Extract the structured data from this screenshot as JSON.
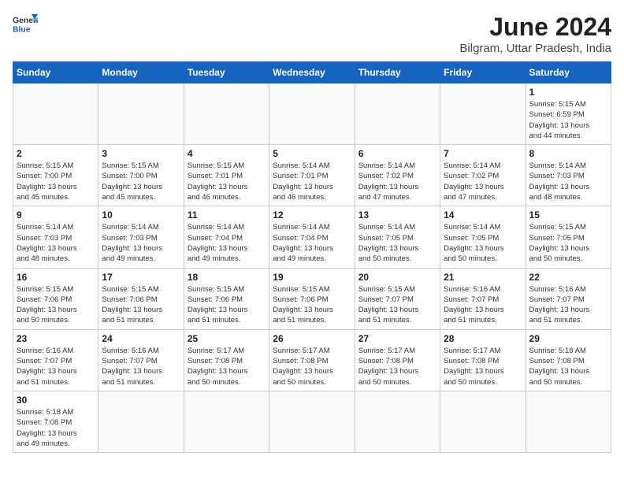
{
  "header": {
    "logo_general": "General",
    "logo_blue": "Blue",
    "month_title": "June 2024",
    "subtitle": "Bilgram, Uttar Pradesh, India"
  },
  "weekdays": [
    "Sunday",
    "Monday",
    "Tuesday",
    "Wednesday",
    "Thursday",
    "Friday",
    "Saturday"
  ],
  "weeks": [
    [
      {
        "day": "",
        "info": ""
      },
      {
        "day": "",
        "info": ""
      },
      {
        "day": "",
        "info": ""
      },
      {
        "day": "",
        "info": ""
      },
      {
        "day": "",
        "info": ""
      },
      {
        "day": "",
        "info": ""
      },
      {
        "day": "1",
        "info": "Sunrise: 5:15 AM\nSunset: 6:59 PM\nDaylight: 13 hours\nand 44 minutes."
      }
    ],
    [
      {
        "day": "2",
        "info": "Sunrise: 5:15 AM\nSunset: 7:00 PM\nDaylight: 13 hours\nand 45 minutes."
      },
      {
        "day": "3",
        "info": "Sunrise: 5:15 AM\nSunset: 7:00 PM\nDaylight: 13 hours\nand 45 minutes."
      },
      {
        "day": "4",
        "info": "Sunrise: 5:15 AM\nSunset: 7:01 PM\nDaylight: 13 hours\nand 46 minutes."
      },
      {
        "day": "5",
        "info": "Sunrise: 5:14 AM\nSunset: 7:01 PM\nDaylight: 13 hours\nand 46 minutes."
      },
      {
        "day": "6",
        "info": "Sunrise: 5:14 AM\nSunset: 7:02 PM\nDaylight: 13 hours\nand 47 minutes."
      },
      {
        "day": "7",
        "info": "Sunrise: 5:14 AM\nSunset: 7:02 PM\nDaylight: 13 hours\nand 47 minutes."
      },
      {
        "day": "8",
        "info": "Sunrise: 5:14 AM\nSunset: 7:03 PM\nDaylight: 13 hours\nand 48 minutes."
      }
    ],
    [
      {
        "day": "9",
        "info": "Sunrise: 5:14 AM\nSunset: 7:03 PM\nDaylight: 13 hours\nand 48 minutes."
      },
      {
        "day": "10",
        "info": "Sunrise: 5:14 AM\nSunset: 7:03 PM\nDaylight: 13 hours\nand 49 minutes."
      },
      {
        "day": "11",
        "info": "Sunrise: 5:14 AM\nSunset: 7:04 PM\nDaylight: 13 hours\nand 49 minutes."
      },
      {
        "day": "12",
        "info": "Sunrise: 5:14 AM\nSunset: 7:04 PM\nDaylight: 13 hours\nand 49 minutes."
      },
      {
        "day": "13",
        "info": "Sunrise: 5:14 AM\nSunset: 7:05 PM\nDaylight: 13 hours\nand 50 minutes."
      },
      {
        "day": "14",
        "info": "Sunrise: 5:14 AM\nSunset: 7:05 PM\nDaylight: 13 hours\nand 50 minutes."
      },
      {
        "day": "15",
        "info": "Sunrise: 5:15 AM\nSunset: 7:05 PM\nDaylight: 13 hours\nand 50 minutes."
      }
    ],
    [
      {
        "day": "16",
        "info": "Sunrise: 5:15 AM\nSunset: 7:06 PM\nDaylight: 13 hours\nand 50 minutes."
      },
      {
        "day": "17",
        "info": "Sunrise: 5:15 AM\nSunset: 7:06 PM\nDaylight: 13 hours\nand 51 minutes."
      },
      {
        "day": "18",
        "info": "Sunrise: 5:15 AM\nSunset: 7:06 PM\nDaylight: 13 hours\nand 51 minutes."
      },
      {
        "day": "19",
        "info": "Sunrise: 5:15 AM\nSunset: 7:06 PM\nDaylight: 13 hours\nand 51 minutes."
      },
      {
        "day": "20",
        "info": "Sunrise: 5:15 AM\nSunset: 7:07 PM\nDaylight: 13 hours\nand 51 minutes."
      },
      {
        "day": "21",
        "info": "Sunrise: 5:16 AM\nSunset: 7:07 PM\nDaylight: 13 hours\nand 51 minutes."
      },
      {
        "day": "22",
        "info": "Sunrise: 5:16 AM\nSunset: 7:07 PM\nDaylight: 13 hours\nand 51 minutes."
      }
    ],
    [
      {
        "day": "23",
        "info": "Sunrise: 5:16 AM\nSunset: 7:07 PM\nDaylight: 13 hours\nand 51 minutes."
      },
      {
        "day": "24",
        "info": "Sunrise: 5:16 AM\nSunset: 7:07 PM\nDaylight: 13 hours\nand 51 minutes."
      },
      {
        "day": "25",
        "info": "Sunrise: 5:17 AM\nSunset: 7:08 PM\nDaylight: 13 hours\nand 50 minutes."
      },
      {
        "day": "26",
        "info": "Sunrise: 5:17 AM\nSunset: 7:08 PM\nDaylight: 13 hours\nand 50 minutes."
      },
      {
        "day": "27",
        "info": "Sunrise: 5:17 AM\nSunset: 7:08 PM\nDaylight: 13 hours\nand 50 minutes."
      },
      {
        "day": "28",
        "info": "Sunrise: 5:17 AM\nSunset: 7:08 PM\nDaylight: 13 hours\nand 50 minutes."
      },
      {
        "day": "29",
        "info": "Sunrise: 5:18 AM\nSunset: 7:08 PM\nDaylight: 13 hours\nand 50 minutes."
      }
    ],
    [
      {
        "day": "30",
        "info": "Sunrise: 5:18 AM\nSunset: 7:08 PM\nDaylight: 13 hours\nand 49 minutes."
      },
      {
        "day": "",
        "info": ""
      },
      {
        "day": "",
        "info": ""
      },
      {
        "day": "",
        "info": ""
      },
      {
        "day": "",
        "info": ""
      },
      {
        "day": "",
        "info": ""
      },
      {
        "day": "",
        "info": ""
      }
    ]
  ]
}
